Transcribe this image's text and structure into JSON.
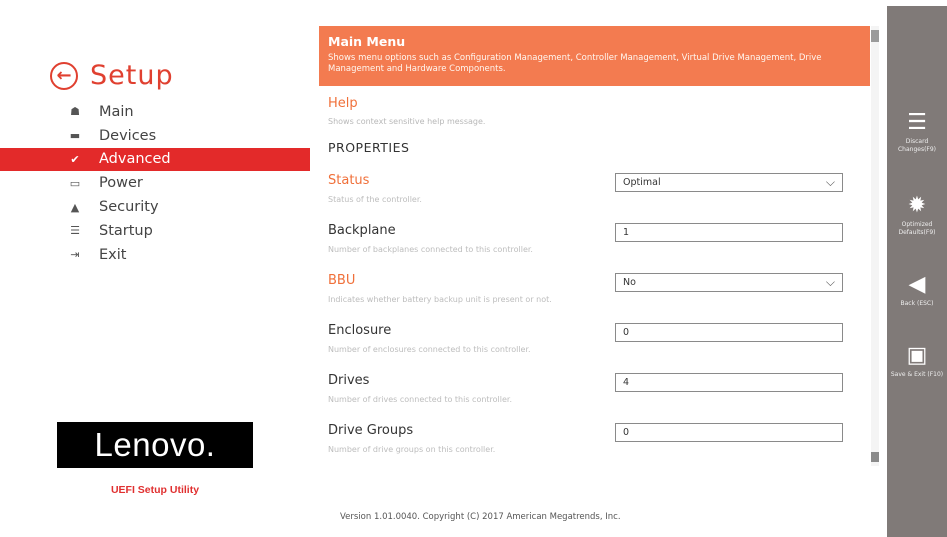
{
  "sidebar": {
    "title": "Setup",
    "items": [
      {
        "label": "Main",
        "icon": "home-icon",
        "glyph": "☗"
      },
      {
        "label": "Devices",
        "icon": "devices-icon",
        "glyph": "▬"
      },
      {
        "label": "Advanced",
        "icon": "wrench-icon",
        "glyph": "✔"
      },
      {
        "label": "Power",
        "icon": "power-icon",
        "glyph": "▭"
      },
      {
        "label": "Security",
        "icon": "lock-icon",
        "glyph": "▲"
      },
      {
        "label": "Startup",
        "icon": "startup-icon",
        "glyph": "☰"
      },
      {
        "label": "Exit",
        "icon": "exit-icon",
        "glyph": "⇥"
      }
    ],
    "active_index": 2,
    "brand": "Lenovo.",
    "brand_subtitle": "UEFI Setup Utility"
  },
  "main": {
    "banner_title": "Main Menu",
    "banner_desc": "Shows menu options such as Configuration Management, Controller Management, Virtual Drive Management, Drive Management and Hardware Components.",
    "help_title": "Help",
    "help_desc": "Shows context sensitive help message.",
    "section_title": "PROPERTIES",
    "properties": [
      {
        "label": "Status",
        "value": "Optimal",
        "type": "select",
        "highlight": true,
        "desc": "Status of the controller."
      },
      {
        "label": "Backplane",
        "value": "1",
        "type": "text",
        "highlight": false,
        "desc": "Number of backplanes connected to this controller."
      },
      {
        "label": "BBU",
        "value": "No",
        "type": "select",
        "highlight": true,
        "desc": "Indicates whether battery backup unit is present or not."
      },
      {
        "label": "Enclosure",
        "value": "0",
        "type": "text",
        "highlight": false,
        "desc": "Number of enclosures connected to this controller."
      },
      {
        "label": "Drives",
        "value": "4",
        "type": "text",
        "highlight": false,
        "desc": "Number of drives connected to this controller."
      },
      {
        "label": "Drive Groups",
        "value": "0",
        "type": "text",
        "highlight": false,
        "desc": "Number of drive groups on this controller."
      }
    ]
  },
  "footer": {
    "version": "Version 1.01.0040. Copyright (C) 2017 American Megatrends, Inc."
  },
  "actions": [
    {
      "label": "Discard Changes(F9)",
      "icon": "sliders-icon",
      "glyph": "☰"
    },
    {
      "label": "Optimized Defaults(F9)",
      "icon": "gear-icon",
      "glyph": "✹"
    },
    {
      "label": "Back (ESC)",
      "icon": "back-arrow-icon",
      "glyph": "◀"
    },
    {
      "label": "Save & Exit (F10)",
      "icon": "save-icon",
      "glyph": "▣"
    }
  ],
  "colors": {
    "accent": "#e32a2a",
    "banner": "#f37b50",
    "actionbar": "#807a78"
  }
}
